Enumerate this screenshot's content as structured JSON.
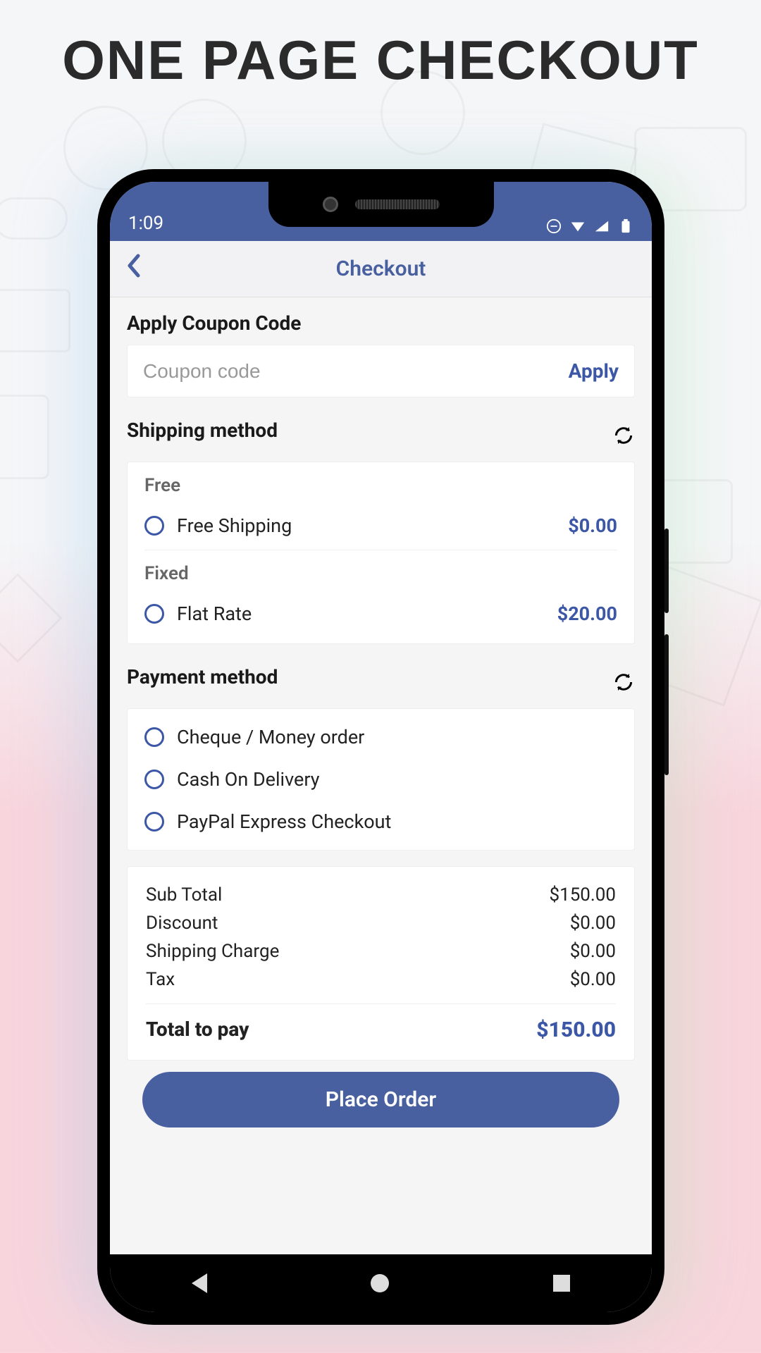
{
  "promo_title": "ONE PAGE CHECKOUT",
  "status": {
    "time": "1:09"
  },
  "header": {
    "title": "Checkout"
  },
  "coupon": {
    "section_title": "Apply Coupon Code",
    "placeholder": "Coupon code",
    "apply_label": "Apply"
  },
  "shipping": {
    "section_title": "Shipping method",
    "groups": [
      {
        "label": "Free",
        "option": {
          "name": "Free Shipping",
          "price": "$0.00"
        }
      },
      {
        "label": "Fixed",
        "option": {
          "name": "Flat Rate",
          "price": "$20.00"
        }
      }
    ]
  },
  "payment": {
    "section_title": "Payment method",
    "options": [
      "Cheque / Money order",
      "Cash On Delivery",
      "PayPal Express Checkout"
    ]
  },
  "totals": {
    "rows": [
      {
        "label": "Sub Total",
        "value": "$150.00"
      },
      {
        "label": "Discount",
        "value": "$0.00"
      },
      {
        "label": "Shipping Charge",
        "value": "$0.00"
      },
      {
        "label": "Tax",
        "value": "$0.00"
      }
    ],
    "total_label": "Total to pay",
    "total_value": "$150.00"
  },
  "place_order_label": "Place Order"
}
